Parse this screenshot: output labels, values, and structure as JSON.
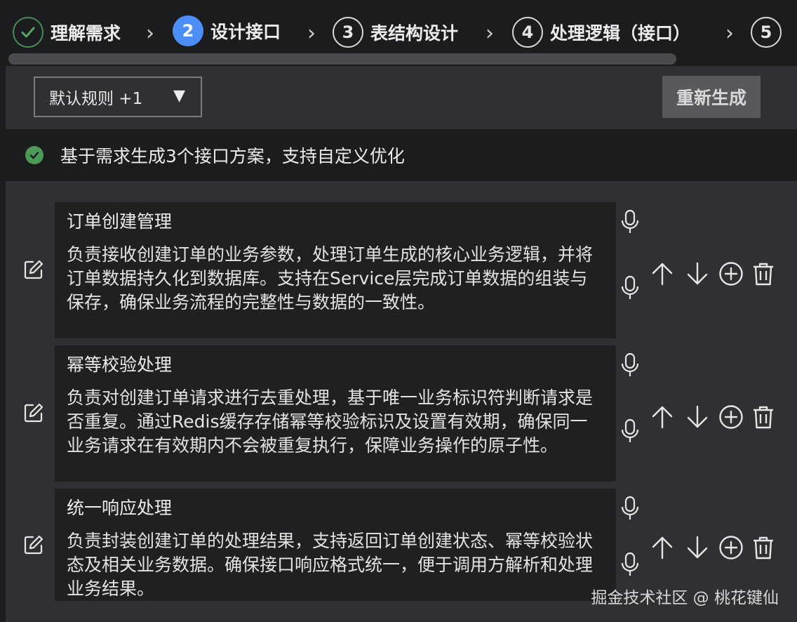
{
  "stepper": {
    "steps": [
      {
        "number": "✔",
        "label": "理解需求",
        "state": "done"
      },
      {
        "number": "2",
        "label": "设计接口",
        "state": "active"
      },
      {
        "number": "3",
        "label": "表结构设计",
        "state": "pending"
      },
      {
        "number": "4",
        "label": "处理逻辑（接口）",
        "state": "pending"
      },
      {
        "number": "5",
        "label": "",
        "state": "pending"
      }
    ]
  },
  "toolbar": {
    "rule_select_value": "默认规则 +1",
    "regenerate_label": "重新生成"
  },
  "status": {
    "message": "基于需求生成3个接口方案，支持自定义优化"
  },
  "items": [
    {
      "title": "订单创建管理",
      "description": "负责接收创建订单的业务参数，处理订单生成的核心业务逻辑，并将订单数据持久化到数据库。支持在Service层完成订单数据的组装与保存，确保业务流程的完整性与数据的一致性。"
    },
    {
      "title": "幂等校验处理",
      "description": "负责对创建订单请求进行去重处理，基于唯一业务标识符判断请求是否重复。通过Redis缓存存储幂等校验标识及设置有效期，确保同一业务请求在有效期内不会被重复执行，保障业务操作的原子性。"
    },
    {
      "title": "统一响应处理",
      "description": "负责封装创建订单的处理结果，支持返回订单创建状态、幂等校验状态及相关业务数据。确保接口响应格式统一，便于调用方解析和处理业务结果。"
    }
  ],
  "icons": {
    "edit": "edit-icon",
    "mic": "microphone-icon",
    "up": "arrow-up-icon",
    "down": "arrow-down-icon",
    "add": "add-circle-icon",
    "delete": "trash-icon"
  },
  "watermark": "掘金技术社区 @ 桃花键仙",
  "colors": {
    "active_step": "#4c8ef7",
    "done_step": "#4b9a57",
    "background": "#2e3033",
    "card": "#1f2022"
  }
}
